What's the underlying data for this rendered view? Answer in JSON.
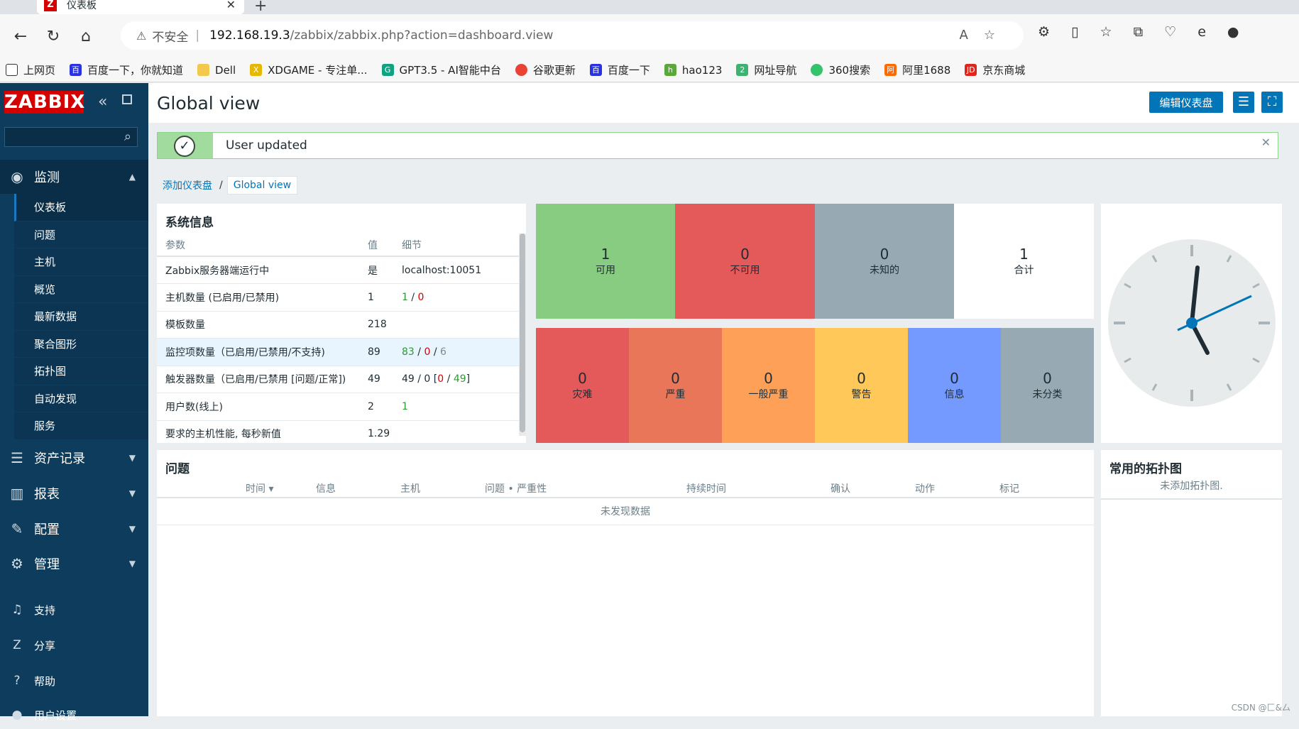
{
  "browser": {
    "tab_title": "仪表板",
    "url_warning": "不安全",
    "url_host": "192.168.19.3",
    "url_path": "/zabbix/zabbix.php?action=dashboard.view",
    "bookmarks": [
      "上网页",
      "百度一下，你就知道",
      "Dell",
      "XDGAME - 专注单...",
      "GPT3.5 - AI智能中台",
      "谷歌更新",
      "百度一下",
      "hao123",
      "网址导航",
      "360搜索",
      "阿里1688",
      "京东商城"
    ]
  },
  "sidebar": {
    "logo": "ZABBIX",
    "monitor": "监测",
    "submenu": [
      "仪表板",
      "问题",
      "主机",
      "概览",
      "最新数据",
      "聚合图形",
      "拓扑图",
      "自动发现",
      "服务"
    ],
    "inventory": "资产记录",
    "reports": "报表",
    "config": "配置",
    "admin": "管理",
    "support": "支持",
    "share": "分享",
    "help": "帮助",
    "user_settings": "用户设置"
  },
  "header": {
    "title": "Global view",
    "edit_button": "编辑仪表盘"
  },
  "message": {
    "text": "User updated"
  },
  "breadcrumb": {
    "parent": "添加仪表盘",
    "current": "Global view"
  },
  "system_info": {
    "title": "系统信息",
    "columns": [
      "参数",
      "值",
      "细节"
    ],
    "rows": [
      {
        "param": "Zabbix服务器端运行中",
        "value": "是",
        "detail": "localhost:10051"
      },
      {
        "param": "主机数量 (已启用/已禁用)",
        "value": "1",
        "d1": "1",
        "d2": "0"
      },
      {
        "param": "模板数量",
        "value": "218",
        "detail": ""
      },
      {
        "param": "监控项数量（已启用/已禁用/不支持)",
        "value": "89",
        "d1": "83",
        "d2": "0",
        "d3": "6"
      },
      {
        "param": "触发器数量（已启用/已禁用 [问题/正常])",
        "value": "49",
        "d_pre": "49 / 0 [",
        "d1": "0",
        "d2": "49",
        "d_post": "]"
      },
      {
        "param": "用户数(线上)",
        "value": "2",
        "d1": "1"
      },
      {
        "param": "要求的主机性能, 每秒新值",
        "value": "1.29",
        "detail": ""
      }
    ]
  },
  "host_availability": [
    {
      "count": "1",
      "label": "可用",
      "color": "#88cc82"
    },
    {
      "count": "0",
      "label": "不可用",
      "color": "#e45959"
    },
    {
      "count": "0",
      "label": "未知的",
      "color": "#97aab3"
    },
    {
      "count": "1",
      "label": "合计",
      "color": "#ffffff"
    }
  ],
  "problems_by_severity": [
    {
      "count": "0",
      "label": "灾难",
      "color": "#e45959"
    },
    {
      "count": "0",
      "label": "严重",
      "color": "#e97659"
    },
    {
      "count": "0",
      "label": "一般严重",
      "color": "#ffa059"
    },
    {
      "count": "0",
      "label": "警告",
      "color": "#ffc859"
    },
    {
      "count": "0",
      "label": "信息",
      "color": "#7499ff"
    },
    {
      "count": "0",
      "label": "未分类",
      "color": "#97aab3"
    }
  ],
  "problems": {
    "title": "问题",
    "columns": [
      "时间 ▾",
      "信息",
      "主机",
      "问题 • 严重性",
      "持续时间",
      "确认",
      "动作",
      "标记"
    ],
    "empty": "未发现数据"
  },
  "maps": {
    "title": "常用的拓扑图",
    "empty": "未添加拓扑图."
  },
  "watermark": "CSDN @匚&厶"
}
